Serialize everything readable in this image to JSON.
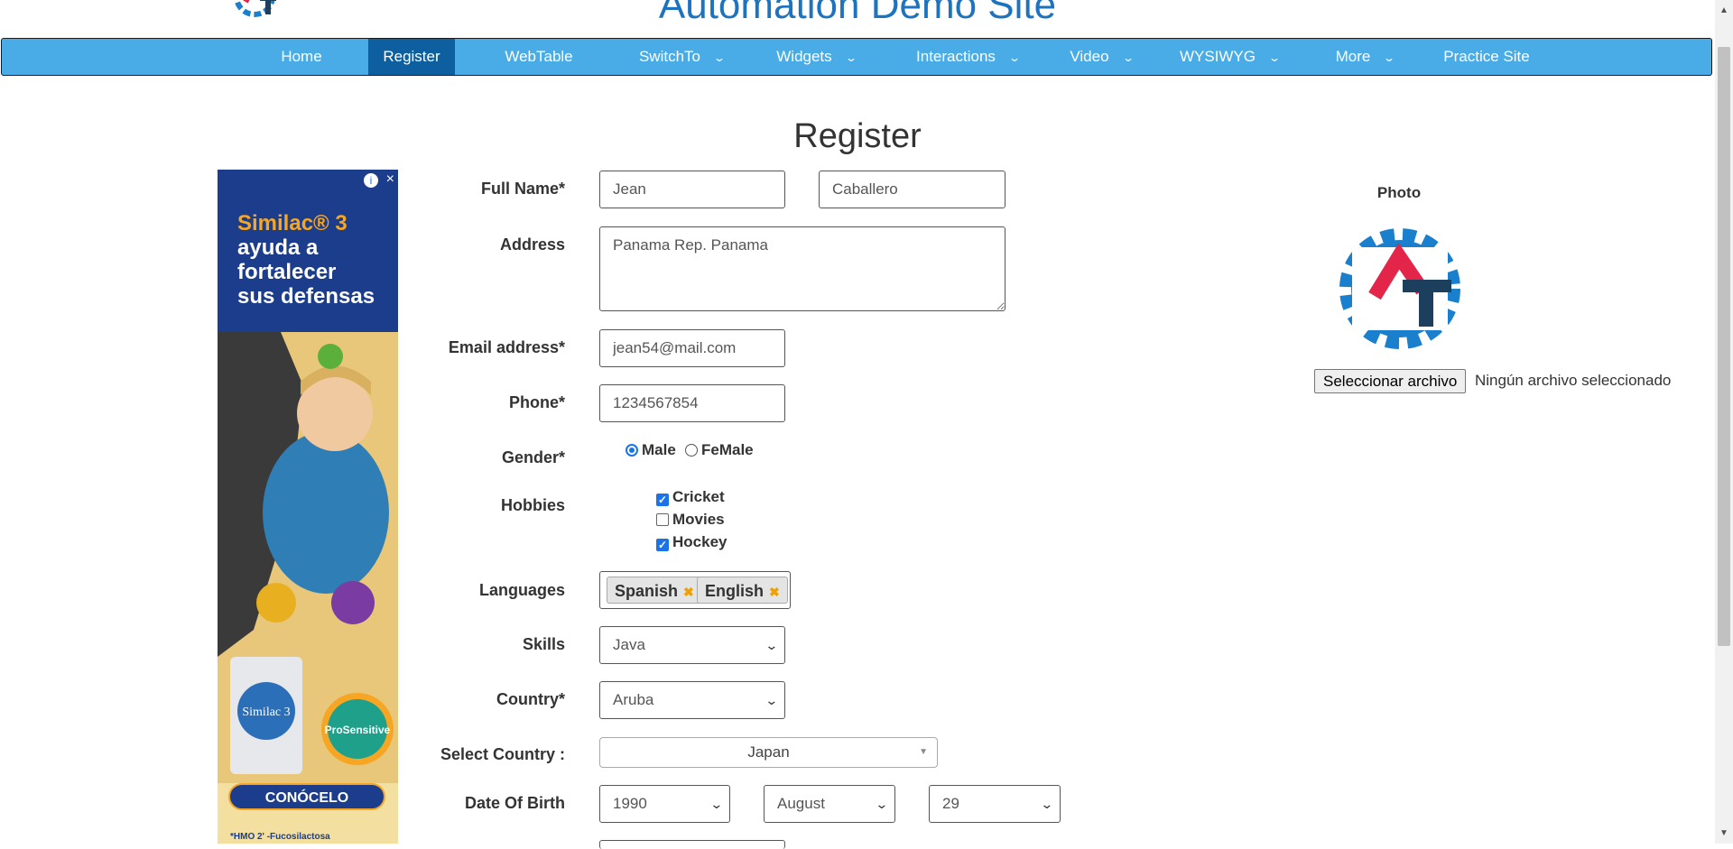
{
  "site": {
    "title": "Automation Demo Site"
  },
  "nav": {
    "items": [
      {
        "label": "Home"
      },
      {
        "label": "Register"
      },
      {
        "label": "WebTable"
      },
      {
        "label": "SwitchTo"
      },
      {
        "label": "Widgets"
      },
      {
        "label": "Interactions"
      },
      {
        "label": "Video"
      },
      {
        "label": "WYSIWYG"
      },
      {
        "label": "More"
      },
      {
        "label": "Practice Site"
      }
    ],
    "active": "Register",
    "chevron": "⌄"
  },
  "page": {
    "heading": "Register"
  },
  "ad": {
    "headline_brand": "Similac® 3",
    "headline_lines": [
      "ayuda a",
      "fortalecer",
      "sus defensas"
    ],
    "info": "i",
    "close": "×",
    "cta": "CONÓCELO",
    "footnote": "*HMO 2' -Fucosilactosa",
    "product_main": "Similac 3",
    "product_badge": "ProSensitive"
  },
  "form": {
    "full_name_label": "Full Name*",
    "first_name": "Jean",
    "last_name": "Caballero",
    "address_label": "Address",
    "address": "Panama Rep. Panama",
    "email_label": "Email address*",
    "email": "jean54@mail.com",
    "phone_label": "Phone*",
    "phone": "1234567854",
    "gender_label": "Gender*",
    "gender_options": [
      "Male",
      "FeMale"
    ],
    "hobbies_label": "Hobbies",
    "hobbies": [
      {
        "label": "Cricket",
        "checked": true
      },
      {
        "label": "Movies",
        "checked": false
      },
      {
        "label": "Hockey",
        "checked": true
      }
    ],
    "languages_label": "Languages",
    "languages": [
      "Spanish",
      "English"
    ],
    "skills_label": "Skills",
    "skills_value": "Java",
    "country_label": "Country*",
    "country_value": "Aruba",
    "select_country_label": "Select Country :",
    "select_country_value": "Japan",
    "dob_label": "Date Of Birth",
    "dob_year": "1990",
    "dob_month": "August",
    "dob_day": "29"
  },
  "photo": {
    "label": "Photo",
    "button": "Seleccionar archivo",
    "no_file": "Ningún archivo seleccionado"
  },
  "colors": {
    "nav_bg": "#49ace7",
    "nav_active": "#0d5fa0",
    "title": "#1e73be",
    "logo_red": "#e3254a",
    "logo_dark": "#1d3f5e",
    "logo_blue": "#1a7fcc"
  }
}
